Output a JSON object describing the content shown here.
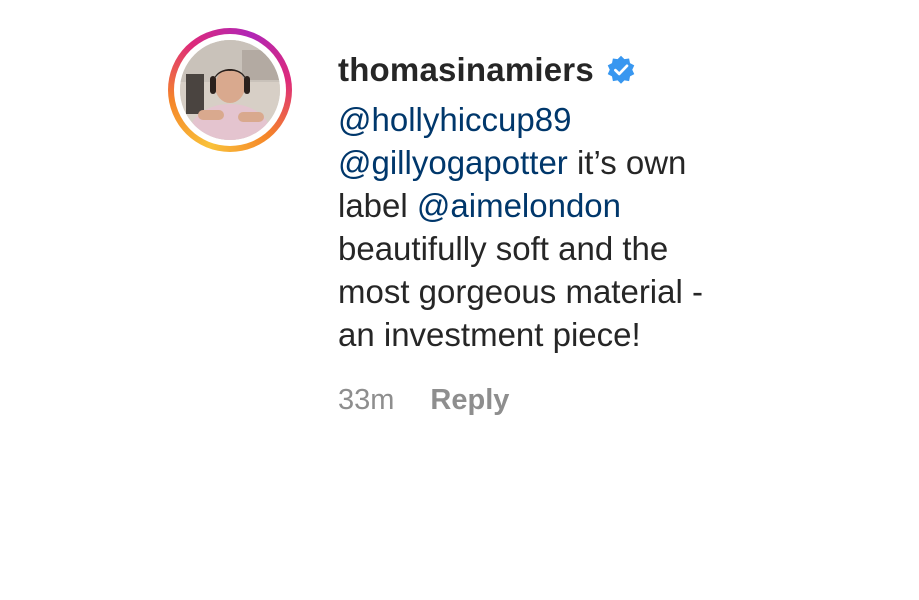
{
  "comment": {
    "username": "thomasinamiers",
    "verified_icon": "verified-badge-icon",
    "avatar_icon": "profile-photo",
    "mentions": {
      "first": "@hollyhiccup89",
      "second": "@gillyogapotter",
      "third": "@aimelondon"
    },
    "text_parts": {
      "after_second": " it’s own",
      "before_third": "label ",
      "line4": "beautifully soft and the",
      "line5": "most gorgeous material -",
      "line6": "an investment piece!"
    },
    "timestamp": "33m",
    "reply_label": "Reply"
  },
  "colors": {
    "text": "#262626",
    "mention": "#00376b",
    "muted": "#8e8e8e",
    "verified": "#3897f0"
  }
}
